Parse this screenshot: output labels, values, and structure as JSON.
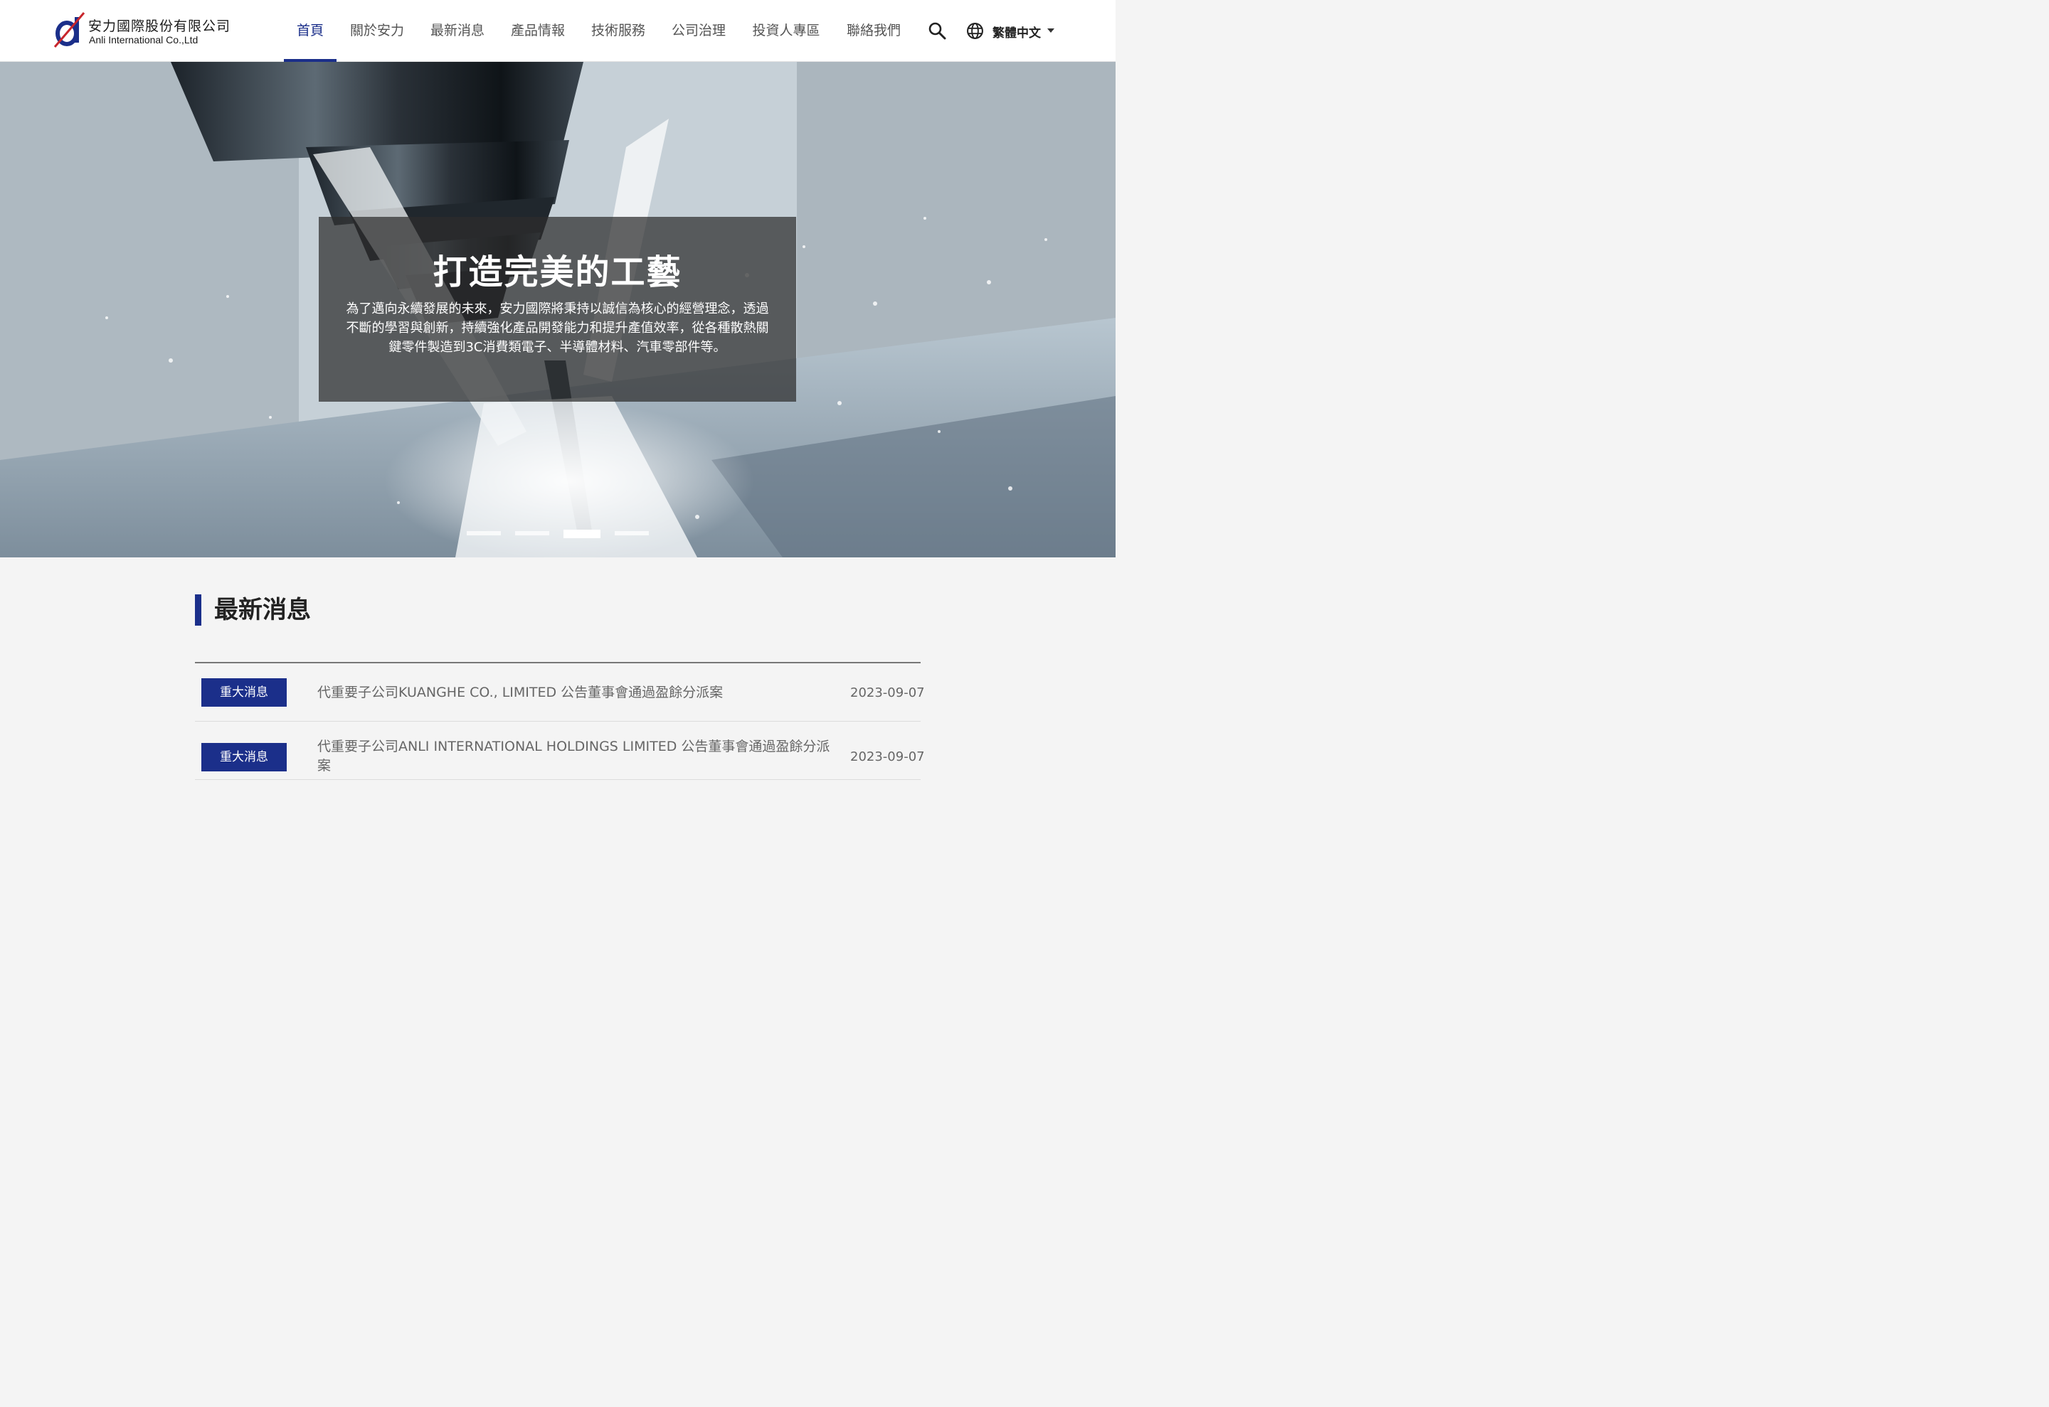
{
  "brand": {
    "name_cn": "安力國際股份有限公司",
    "name_en": "Anli International Co.,Ltd",
    "logo_icon": "anli-logo-mark",
    "primary_color": "#1b2f8a",
    "logo_accent": "#c8262c"
  },
  "nav": {
    "items": [
      {
        "label": "首頁",
        "active": true
      },
      {
        "label": "關於安力"
      },
      {
        "label": "最新消息"
      },
      {
        "label": "產品情報"
      },
      {
        "label": "技術服務"
      },
      {
        "label": "公司治理"
      },
      {
        "label": "投資人專區"
      },
      {
        "label": "聯絡我們"
      }
    ],
    "search_icon": "search-icon",
    "language": {
      "label": "繁體中文",
      "icon": "globe-icon"
    }
  },
  "hero": {
    "title": "打造完美的工藝",
    "text": "為了邁向永續發展的未來，安力國際將秉持以誠信為核心的經營理念，透過不斷的學習與創新，持續強化產品開發能力和提升產值效率，從各種散熱關鍵零件製造到3C消費類電子、半導體材料、汽車零部件等。",
    "slides_total": 4,
    "active_slide": 3
  },
  "news": {
    "heading": "最新消息",
    "items": [
      {
        "badge": "重大消息",
        "title": "代重要子公司KUANGHE CO., LIMITED 公告董事會通過盈餘分派案",
        "date": "2023-09-07"
      },
      {
        "badge": "重大消息",
        "title": "代重要子公司ANLI INTERNATIONAL HOLDINGS LIMITED 公告董事會通過盈餘分派案",
        "date": "2023-09-07"
      }
    ]
  }
}
